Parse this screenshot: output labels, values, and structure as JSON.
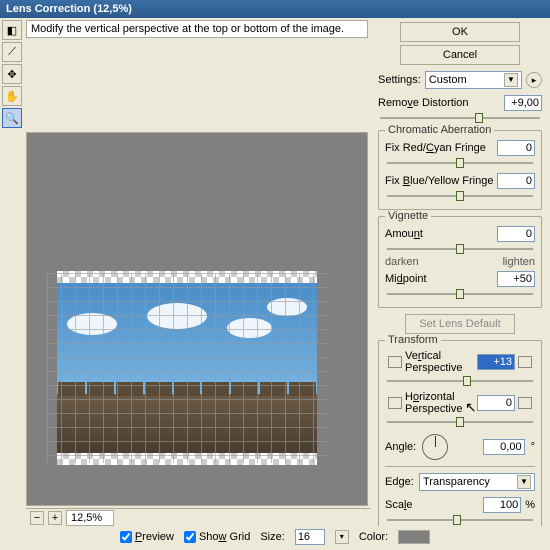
{
  "title": "Lens Correction (12,5%)",
  "hint": "Modify the vertical perspective at the top or bottom of the image.",
  "buttons": {
    "ok": "OK",
    "cancel": "Cancel",
    "setdefault": "Set Lens Default"
  },
  "settings": {
    "label": "Settings:",
    "value": "Custom"
  },
  "remove_distortion": {
    "label": "Remove Distortion",
    "value": "+9,00",
    "pos": 62
  },
  "chromatic": {
    "title": "Chromatic Aberration",
    "red": {
      "label": "Fix Red/Cyan Fringe",
      "value": "0",
      "pos": 50
    },
    "blue": {
      "label": "Fix Blue/Yellow Fringe",
      "value": "0",
      "pos": 50
    }
  },
  "vignette": {
    "title": "Vignette",
    "amount": {
      "label": "Amount",
      "value": "0",
      "pos": 50,
      "left": "darken",
      "right": "lighten"
    },
    "midpoint": {
      "label": "Midpoint",
      "value": "+50",
      "pos": 50
    }
  },
  "transform": {
    "title": "Transform",
    "vpersp": {
      "label": "Vertical Perspective",
      "value": "+13",
      "pos": 55
    },
    "hpersp": {
      "label": "Horizontal Perspective",
      "value": "0",
      "pos": 50
    },
    "angle": {
      "label": "Angle:",
      "value": "0,00"
    },
    "edge": {
      "label": "Edge:",
      "value": "Transparency"
    },
    "scale": {
      "label": "Scale",
      "value": "100",
      "unit": "%",
      "pos": 48
    }
  },
  "zoom": "12,5%",
  "footer": {
    "preview": "Preview",
    "showgrid": "Show Grid",
    "size": "Size:",
    "size_val": "16",
    "color": "Color:"
  }
}
